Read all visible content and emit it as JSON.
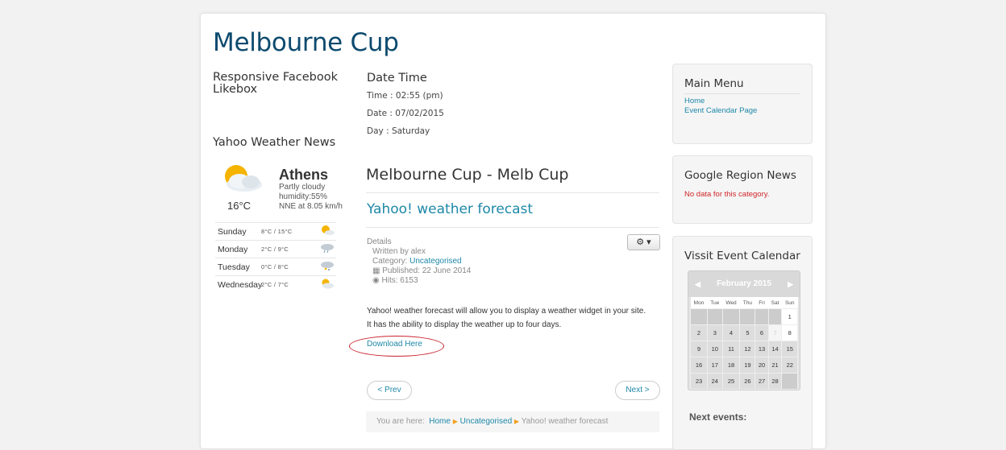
{
  "site": {
    "title": "Melbourne Cup"
  },
  "left": {
    "likebox_title": "Responsive Facebook Likebox",
    "weather_title": "Yahoo Weather News",
    "weather": {
      "temp": "16°C",
      "city": "Athens",
      "condition": "Partly cloudy",
      "humidity": "humidity:55%",
      "wind": "NNE at 8.05 km/h",
      "forecast": [
        {
          "day": "Sunday",
          "temps": "8°C / 15°C",
          "icon": "sun-cloud-icon"
        },
        {
          "day": "Monday",
          "temps": "2°C / 9°C",
          "icon": "rain-cloud-icon"
        },
        {
          "day": "Tuesday",
          "temps": "0°C / 8°C",
          "icon": "snow-cloud-icon"
        },
        {
          "day": "Wednesday",
          "temps": "2°C / 7°C",
          "icon": "partly-cloudy-icon"
        }
      ]
    }
  },
  "datetime": {
    "title": "Date Time",
    "time": "Time : 02:55 (pm)",
    "date": "Date : 07/02/2015",
    "day": "Day : Saturday"
  },
  "article": {
    "page_heading": "Melbourne Cup - Melb Cup",
    "title": "Yahoo! weather forecast",
    "details_label": "Details",
    "written_by": "Written by alex",
    "category_label": "Category:",
    "category_link": "Uncategorised",
    "published": "Published: 22 June 2014",
    "hits": "Hits: 6153",
    "gear_label": "⚙ ▾",
    "body_1": "Yahoo! weather forecast will allow you to display a weather widget in your site.",
    "body_2": "It has the ability to display the weather up to four days.",
    "download": "Download Here",
    "prev": "< Prev",
    "next": "Next >",
    "breadcrumb": {
      "prefix": "You are here:",
      "home": "Home",
      "cat": "Uncategorised",
      "current": "Yahoo! weather forecast"
    }
  },
  "sidebar": {
    "main_menu": {
      "title": "Main Menu",
      "items": [
        "Home",
        "Event Calendar Page"
      ]
    },
    "google_news": {
      "title": "Google Region News",
      "message": "No data for this category."
    },
    "event_calendar": {
      "title": "Vissit Event Calendar",
      "month": "February 2015",
      "prev_arrow": "◀",
      "next_arrow": "▶",
      "weekdays": [
        "Mon",
        "Tue",
        "Wed",
        "Thu",
        "Fri",
        "Sat",
        "Sun"
      ],
      "weeks": [
        [
          "",
          "",
          "",
          "",
          "",
          "",
          "1"
        ],
        [
          "2",
          "3",
          "4",
          "5",
          "6",
          "7",
          "8"
        ],
        [
          "9",
          "10",
          "11",
          "12",
          "13",
          "14",
          "15"
        ],
        [
          "16",
          "17",
          "18",
          "19",
          "20",
          "21",
          "22"
        ],
        [
          "23",
          "24",
          "25",
          "26",
          "27",
          "28",
          ""
        ]
      ],
      "next_events": "Next events:"
    }
  },
  "colors": {
    "title": "#0d4a6e",
    "link": "#1e88a8",
    "error": "#d0262a",
    "annotation": "#c8232c"
  }
}
